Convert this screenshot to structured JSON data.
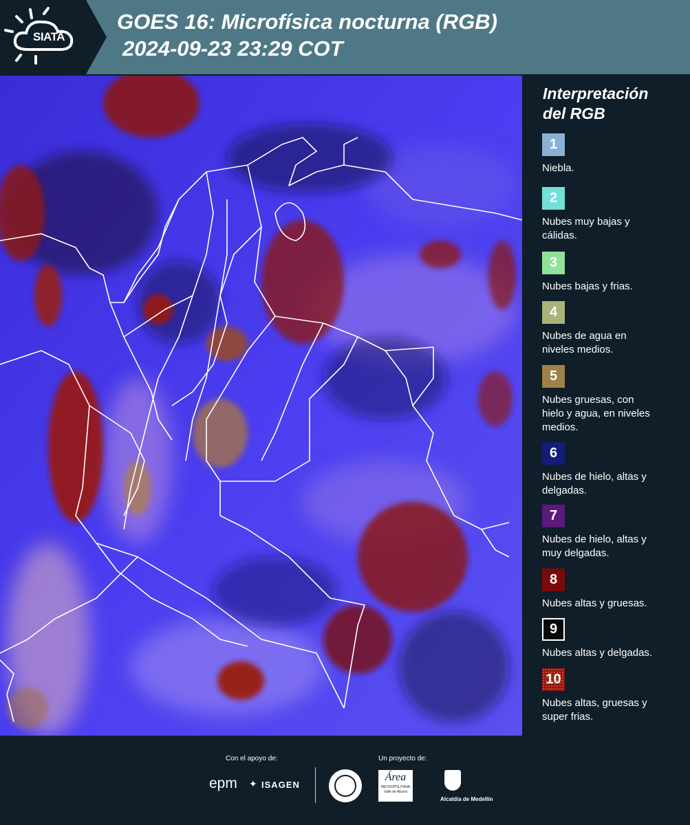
{
  "header": {
    "logo_text": "SIATA",
    "title_line1": "GOES 16: Microfísica nocturna (RGB)",
    "title_line2": "2024-09-23 23:29 COT"
  },
  "legend": {
    "title_line1": "Interpretación",
    "title_line2": "del RGB",
    "items": [
      {
        "number": "1",
        "color": "#8ab0d6",
        "line1": "Niebla.",
        "line2": "",
        "line3": ""
      },
      {
        "number": "2",
        "color": "#70e0d8",
        "line1": "Nubes muy bajas y",
        "line2": "cálidas.",
        "line3": ""
      },
      {
        "number": "3",
        "color": "#90e29a",
        "line1": "Nubes bajas y frias.",
        "line2": "",
        "line3": ""
      },
      {
        "number": "4",
        "color": "#a8b478",
        "line1": "Nubes de agua en",
        "line2": "niveles medios.",
        "line3": ""
      },
      {
        "number": "5",
        "color": "#a0804a",
        "line1": "Nubes gruesas, con",
        "line2": "hielo y agua, en niveles",
        "line3": "medios."
      },
      {
        "number": "6",
        "color": "#141c78",
        "line1": "Nubes de hielo, altas y",
        "line2": "delgadas.",
        "line3": ""
      },
      {
        "number": "7",
        "color": "#5a1a7a",
        "line1": "Nubes de hielo, altas y",
        "line2": "muy delgadas.",
        "line3": ""
      },
      {
        "number": "8",
        "color": "#7a0a0a",
        "line1": "Nubes altas y gruesas.",
        "line2": "",
        "line3": ""
      },
      {
        "number": "9",
        "color": "#06070a",
        "line1": "Nubes altas y delgadas.",
        "line2": "",
        "line3": ""
      },
      {
        "number": "10",
        "color": "#8c1a10",
        "line1": "Nubes altas, gruesas y",
        "line2": "super frias.",
        "line3": ""
      }
    ]
  },
  "footer": {
    "support_label": "Con el apoyo de:",
    "project_label": "Un proyecto de:",
    "sponsor_epm": "epm",
    "sponsor_isagen": "ISAGEN",
    "partner_area": "Área",
    "partner_area_line1": "METROPOLITANA",
    "partner_area_line2": "Valle de Aburrá",
    "partner_alcaldia": "Alcaldía de Medellín"
  }
}
